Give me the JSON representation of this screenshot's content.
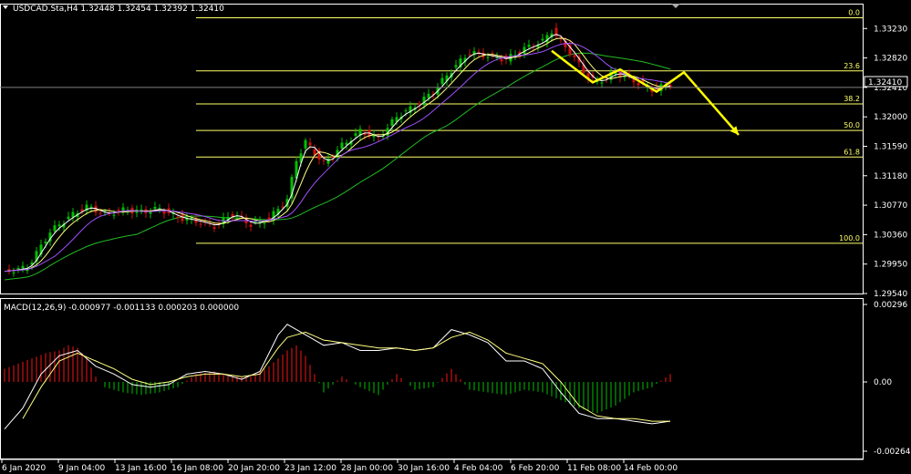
{
  "window": {
    "symbol_line": "USDCAD.Sta,H4  1.32448 1.32454 1.32392 1.32410",
    "menu_icon": "triangle-down-icon"
  },
  "chart_data": [
    {
      "type": "candlestick",
      "panel": "price",
      "ylim": [
        1.2954,
        1.335
      ],
      "y_ticks": [
        "1.33230",
        "1.32820",
        "1.32410",
        "1.32000",
        "1.31590",
        "1.31180",
        "1.30770",
        "1.30360",
        "1.29950",
        "1.29540"
      ],
      "current_price_label": "1.32410",
      "x_tick_labels": [
        "6 Jan 2020",
        "9 Jan 04:00",
        "13 Jan 16:00",
        "16 Jan 08:00",
        "20 Jan 20:00",
        "23 Jan 12:00",
        "28 Jan 00:00",
        "30 Jan 16:00",
        "4 Feb 04:00",
        "6 Feb 20:00",
        "11 Feb 08:00",
        "14 Feb 00:00"
      ],
      "colors": {
        "up": "#00c000",
        "down": "#d01010",
        "ma_fast": "#ffffff",
        "ma_mid": "#ffff80",
        "ma_slow": "#a050ff",
        "ma_long": "#22bb22",
        "arrow": "#ffff00",
        "fib": "#ffff66"
      },
      "fibonacci": [
        {
          "level": "0.0",
          "price": 1.3338
        },
        {
          "level": "23.6",
          "price": 1.3264
        },
        {
          "level": "38.2",
          "price": 1.3218
        },
        {
          "level": "50.0",
          "price": 1.3181
        },
        {
          "level": "61.8",
          "price": 1.3144
        },
        {
          "level": "100.0",
          "price": 1.3024
        }
      ],
      "close_path": [
        [
          0,
          1.2985
        ],
        [
          5,
          1.299
        ],
        [
          10,
          1.304
        ],
        [
          14,
          1.306
        ],
        [
          18,
          1.3075
        ],
        [
          22,
          1.3065
        ],
        [
          26,
          1.307
        ],
        [
          30,
          1.3068
        ],
        [
          34,
          1.3072
        ],
        [
          38,
          1.306
        ],
        [
          42,
          1.3055
        ],
        [
          46,
          1.3048
        ],
        [
          50,
          1.3065
        ],
        [
          54,
          1.305
        ],
        [
          58,
          1.3058
        ],
        [
          62,
          1.3085
        ],
        [
          64,
          1.314
        ],
        [
          66,
          1.3165
        ],
        [
          70,
          1.3135
        ],
        [
          74,
          1.316
        ],
        [
          78,
          1.318
        ],
        [
          82,
          1.317
        ],
        [
          86,
          1.32
        ],
        [
          90,
          1.3215
        ],
        [
          94,
          1.3235
        ],
        [
          98,
          1.3265
        ],
        [
          102,
          1.329
        ],
        [
          106,
          1.3285
        ],
        [
          110,
          1.328
        ],
        [
          114,
          1.3295
        ],
        [
          118,
          1.3305
        ],
        [
          120,
          1.332
        ],
        [
          122,
          1.3305
        ],
        [
          124,
          1.329
        ],
        [
          128,
          1.3255
        ],
        [
          130,
          1.3248
        ],
        [
          134,
          1.3262
        ],
        [
          138,
          1.325
        ],
        [
          142,
          1.3238
        ],
        [
          146,
          1.3245
        ]
      ],
      "arrow_path": [
        [
          120,
          1.3292
        ],
        [
          129,
          1.3248
        ],
        [
          135,
          1.3266
        ],
        [
          143,
          1.3235
        ],
        [
          149,
          1.3262
        ],
        [
          161,
          1.3175
        ]
      ]
    },
    {
      "type": "histogram",
      "panel": "macd",
      "title": "MACD(12,26,9) -0.000977 -0.001133 0.000203 0.000000",
      "ylim": [
        -0.002647,
        0.00296
      ],
      "y_ticks": [
        "0.00296",
        "0.00",
        "-0.002647"
      ],
      "colors": {
        "positive": "#d01010",
        "negative": "#00a000",
        "macd_line": "#ffffff",
        "signal_line": "#ffff80"
      },
      "histogram": [
        [
          0,
          0.0005
        ],
        [
          3,
          0.0007
        ],
        [
          6,
          0.0009
        ],
        [
          9,
          0.0011
        ],
        [
          12,
          0.0012
        ],
        [
          14,
          0.0014
        ],
        [
          16,
          0.0013
        ],
        [
          18,
          0.0009
        ],
        [
          20,
          0.0002
        ],
        [
          22,
          -0.0002
        ],
        [
          26,
          -0.0004
        ],
        [
          30,
          -0.0005
        ],
        [
          34,
          -0.0004
        ],
        [
          38,
          -0.0002
        ],
        [
          42,
          0.0003
        ],
        [
          46,
          0.0004
        ],
        [
          50,
          0.0002
        ],
        [
          54,
          0.0002
        ],
        [
          58,
          0.0006
        ],
        [
          62,
          0.0012
        ],
        [
          64,
          0.0014
        ],
        [
          66,
          0.001
        ],
        [
          70,
          -0.0004
        ],
        [
          74,
          0.0002
        ],
        [
          78,
          -0.0002
        ],
        [
          82,
          -0.0005
        ],
        [
          86,
          0.0003
        ],
        [
          90,
          -0.0003
        ],
        [
          94,
          -0.0002
        ],
        [
          98,
          0.0005
        ],
        [
          102,
          -0.0003
        ],
        [
          106,
          -0.0004
        ],
        [
          110,
          -0.0005
        ],
        [
          114,
          -0.0003
        ],
        [
          118,
          -0.0004
        ],
        [
          122,
          -0.0007
        ],
        [
          126,
          -0.001
        ],
        [
          130,
          -0.0012
        ],
        [
          134,
          -0.0009
        ],
        [
          138,
          -0.0004
        ],
        [
          142,
          -0.0002
        ],
        [
          146,
          0.0003
        ]
      ],
      "macd_line": [
        [
          0,
          -0.0018
        ],
        [
          4,
          -0.001
        ],
        [
          8,
          0.0003
        ],
        [
          12,
          0.001
        ],
        [
          16,
          0.0012
        ],
        [
          20,
          0.0006
        ],
        [
          24,
          0.0003
        ],
        [
          28,
          -0.0001
        ],
        [
          32,
          -0.0002
        ],
        [
          36,
          -0.0001
        ],
        [
          40,
          0.0003
        ],
        [
          44,
          0.0004
        ],
        [
          48,
          0.0003
        ],
        [
          52,
          0.0001
        ],
        [
          56,
          0.0004
        ],
        [
          60,
          0.0018
        ],
        [
          62,
          0.0022
        ],
        [
          66,
          0.0018
        ],
        [
          70,
          0.0014
        ],
        [
          74,
          0.0015
        ],
        [
          78,
          0.0012
        ],
        [
          82,
          0.0012
        ],
        [
          86,
          0.0013
        ],
        [
          90,
          0.0012
        ],
        [
          94,
          0.0013
        ],
        [
          98,
          0.002
        ],
        [
          102,
          0.0018
        ],
        [
          106,
          0.0015
        ],
        [
          110,
          0.0008
        ],
        [
          114,
          0.0008
        ],
        [
          118,
          0.0005
        ],
        [
          122,
          -0.0004
        ],
        [
          126,
          -0.0012
        ],
        [
          130,
          -0.0014
        ],
        [
          134,
          -0.0014
        ],
        [
          138,
          -0.0015
        ],
        [
          142,
          -0.0016
        ],
        [
          146,
          -0.0015
        ]
      ],
      "signal_line": [
        [
          4,
          -0.0014
        ],
        [
          8,
          -0.0002
        ],
        [
          12,
          0.0008
        ],
        [
          16,
          0.0011
        ],
        [
          20,
          0.0008
        ],
        [
          24,
          0.0005
        ],
        [
          28,
          0.0001
        ],
        [
          32,
          -0.0001
        ],
        [
          36,
          0.0
        ],
        [
          40,
          0.0002
        ],
        [
          44,
          0.0003
        ],
        [
          48,
          0.0003
        ],
        [
          52,
          0.0002
        ],
        [
          56,
          0.0003
        ],
        [
          60,
          0.0013
        ],
        [
          62,
          0.0017
        ],
        [
          66,
          0.0019
        ],
        [
          70,
          0.0016
        ],
        [
          74,
          0.0015
        ],
        [
          78,
          0.0014
        ],
        [
          82,
          0.0013
        ],
        [
          86,
          0.0013
        ],
        [
          90,
          0.0012
        ],
        [
          94,
          0.0013
        ],
        [
          98,
          0.0017
        ],
        [
          102,
          0.0019
        ],
        [
          106,
          0.0016
        ],
        [
          110,
          0.0011
        ],
        [
          114,
          0.0009
        ],
        [
          118,
          0.0007
        ],
        [
          122,
          0.0
        ],
        [
          126,
          -0.0009
        ],
        [
          130,
          -0.0013
        ],
        [
          134,
          -0.0014
        ],
        [
          138,
          -0.0014
        ],
        [
          142,
          -0.0015
        ],
        [
          146,
          -0.0015
        ]
      ]
    }
  ]
}
